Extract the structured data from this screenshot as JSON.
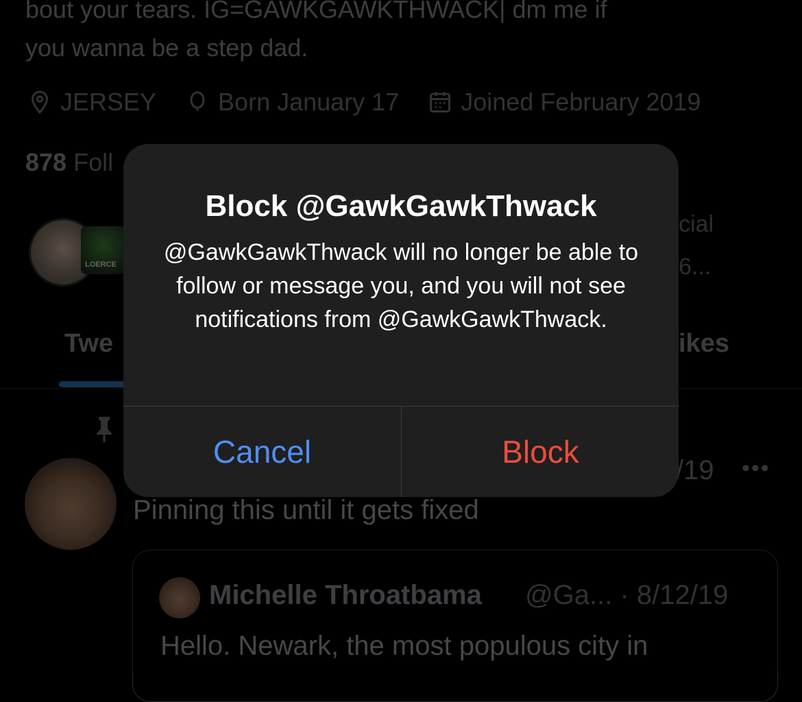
{
  "profile": {
    "bio_line1": "bout your tears. IG=GAWKGAWKTHWACK| dm me if",
    "bio_line2": "you wanna be a step dad.",
    "location": "JERSEY",
    "birthday": "Born January 17",
    "joined": "Joined February 2019",
    "followers_count": "878",
    "followers_label_partial": "Foll",
    "mutuals_partial_1": "cial",
    "mutuals_partial_2": "6...",
    "avatar_badge_text": "LOERCE"
  },
  "tabs": {
    "tweets_partial": "Twe",
    "likes_partial": "ikes"
  },
  "pinned_tweet": {
    "date_partial": "/19",
    "more": "•••",
    "text": "Pinning this until it gets fixed",
    "quote": {
      "name": "Michelle Throatbama",
      "handle_date": "@Ga... · 8/12/19",
      "text": "Hello. Newark, the most populous city in"
    }
  },
  "dialog": {
    "title": "Block @GawkGawkThwack",
    "message": "@GawkGawkThwack will no longer be able to follow or message you, and you will not see notifications from @GawkGawkThwack.",
    "cancel_label": "Cancel",
    "block_label": "Block"
  },
  "colors": {
    "cancel": "#4f8ef7",
    "block": "#eb4d3d",
    "dialog_bg": "#1f1f1f"
  },
  "icons": [
    "location-pin-icon",
    "balloon-icon",
    "calendar-icon",
    "pin-icon"
  ]
}
